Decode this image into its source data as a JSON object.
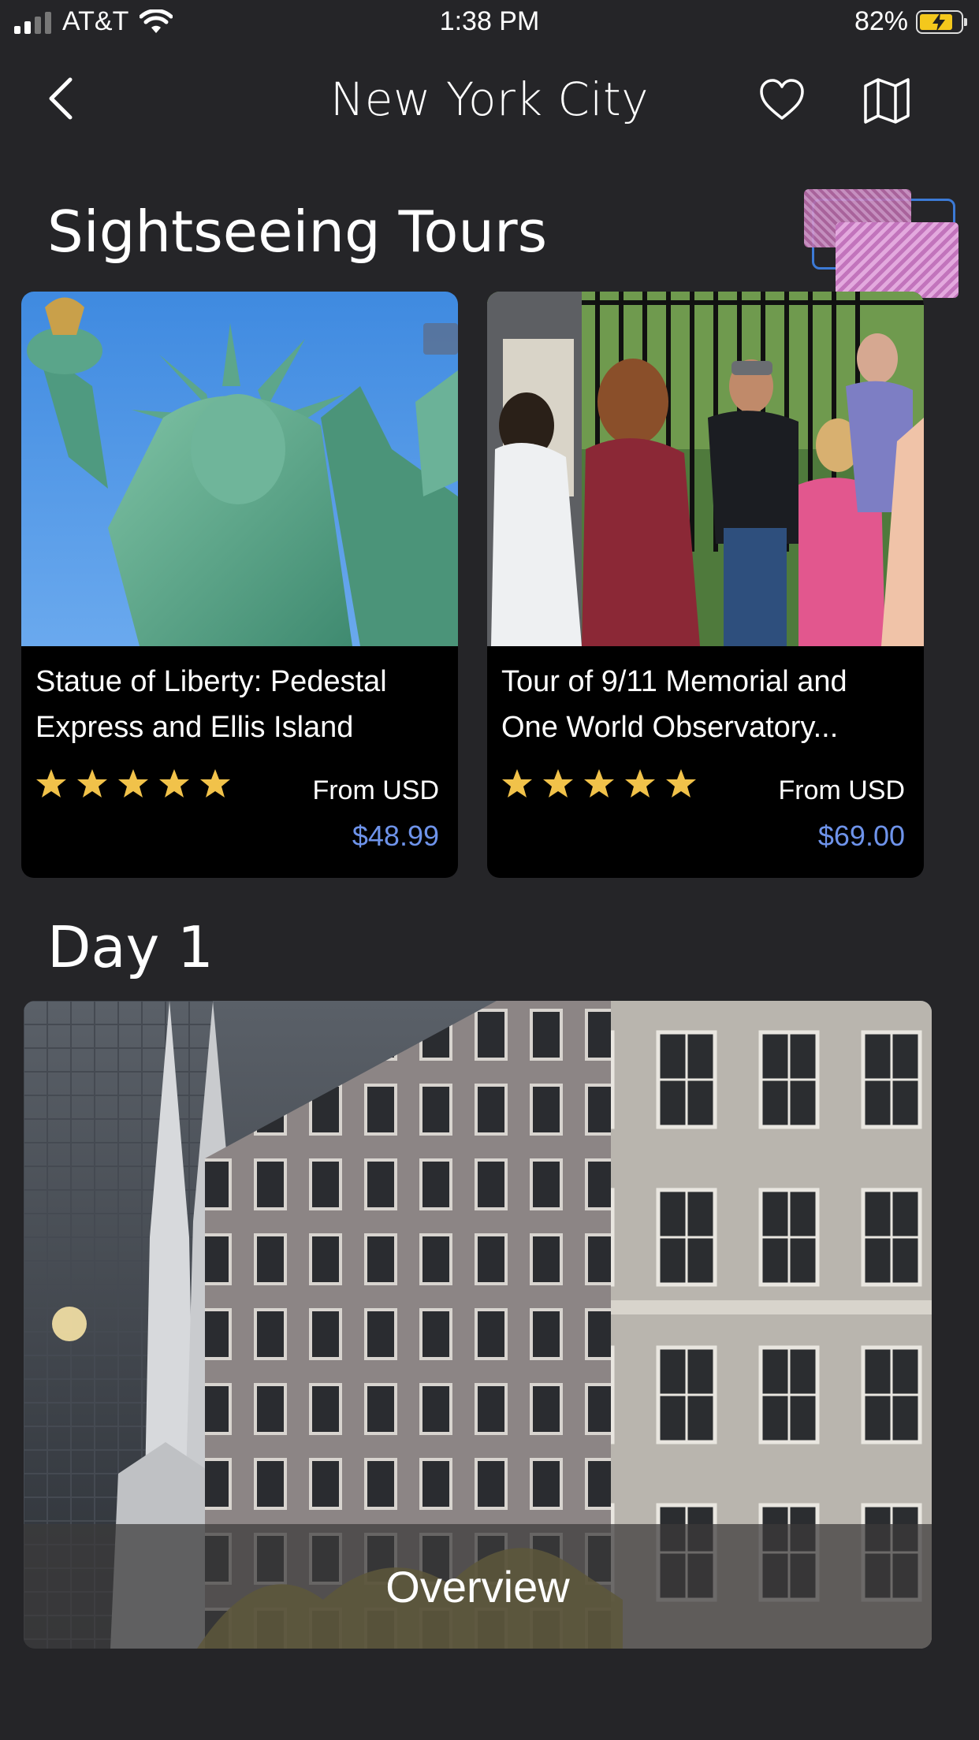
{
  "status_bar": {
    "carrier": "AT&T",
    "time": "1:38 PM",
    "battery_percent": "82%",
    "battery_level": 0.82,
    "battery_charging": true,
    "signal_bars": 2
  },
  "header": {
    "title": "New York City",
    "back_icon": "chevron-left-icon",
    "favorite_icon": "heart-icon",
    "map_icon": "map-icon"
  },
  "sightseeing": {
    "title": "Sightseeing Tours",
    "tours": [
      {
        "name": "Statue of Liberty: Pedestal Express and Ellis Island",
        "rating": 5,
        "from_label": "From USD",
        "price": "$48.99"
      },
      {
        "name": "Tour of 9/11 Memorial and One World Observatory...",
        "rating": 5,
        "from_label": "From USD",
        "price": "$69.00"
      }
    ]
  },
  "day": {
    "title": "Day 1",
    "overview_label": "Overview"
  },
  "colors": {
    "background": "#252528",
    "card": "#000000",
    "star": "#f1c24a",
    "price": "#6e93ea"
  }
}
